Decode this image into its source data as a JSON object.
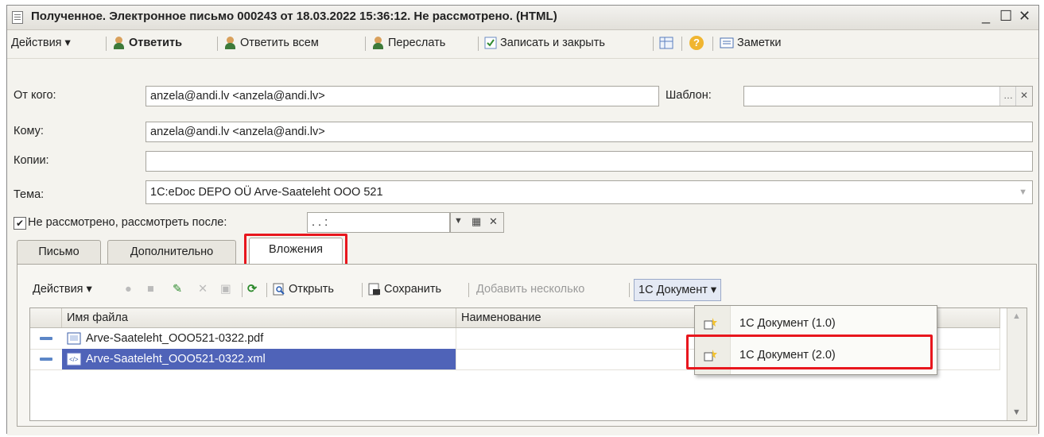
{
  "window": {
    "title": "Полученное. Электронное письмо 000243 от 18.03.2022 15:36:12. Не рассмотрено. (HTML)",
    "minimize": "_",
    "maximize": "☐",
    "close": "✕"
  },
  "toolbar": {
    "actions": "Действия ▾",
    "reply": "Ответить",
    "reply_all": "Ответить всем",
    "forward": "Переслать",
    "save_close": "Записать и закрыть",
    "help": "?",
    "notes": "Заметки"
  },
  "form": {
    "from_label": "От кого:",
    "from_value": "anzela@andi.lv <anzela@andi.lv>",
    "template_label": "Шаблон:",
    "template_value": "",
    "to_label": "Кому:",
    "to_value": "anzela@andi.lv <anzela@andi.lv>",
    "cc_label": "Копии:",
    "cc_value": "",
    "subject_label": "Тема:",
    "subject_value": "1C:eDoc DEPO OÜ Arve-Saateleht OOO 521",
    "review_label": "Не рассмотрено, рассмотреть после:",
    "review_value": " .  .       :",
    "review_checked": true
  },
  "tabs": [
    "Письмо",
    "Дополнительно",
    "Вложения"
  ],
  "active_tab": "Вложения",
  "attachments_toolbar": {
    "actions": "Действия ▾",
    "open": "Открыть",
    "save": "Сохранить",
    "add_several": "Добавить несколько",
    "doc_1c": "1С Документ ▾"
  },
  "table": {
    "columns": [
      "Имя файла",
      "Наименование"
    ],
    "rows": [
      {
        "filename": "Arve-Saateleht_OOO521-0322.pdf",
        "name": ""
      },
      {
        "filename": "Arve-Saateleht_OOO521-0322.xml",
        "name": ""
      }
    ],
    "selected_row": 1
  },
  "dropdown_menu": {
    "items": [
      "1С Документ (1.0)",
      "1С Документ (2.0)"
    ],
    "highlighted": "1С Документ (2.0)"
  },
  "colors": {
    "highlight_red": "#e8161d",
    "selection_blue": "#4f63b8"
  }
}
